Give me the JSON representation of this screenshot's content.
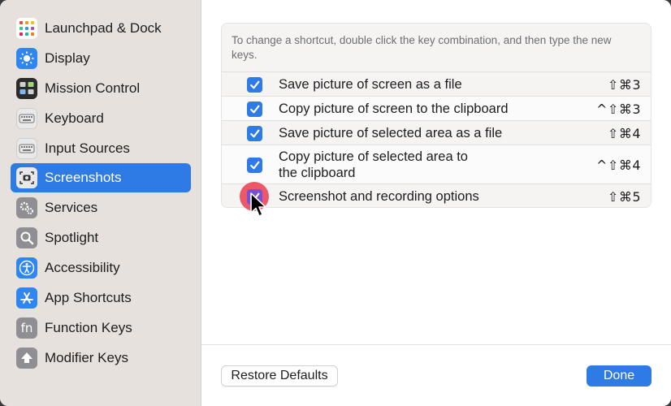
{
  "sidebar": {
    "items": [
      {
        "label": "Launchpad & Dock",
        "icon": "launchpad-icon"
      },
      {
        "label": "Display",
        "icon": "display-icon"
      },
      {
        "label": "Mission Control",
        "icon": "mission-control-icon"
      },
      {
        "label": "Keyboard",
        "icon": "keyboard-icon"
      },
      {
        "label": "Input Sources",
        "icon": "input-sources-icon"
      },
      {
        "label": "Screenshots",
        "icon": "screenshots-icon",
        "selected": true
      },
      {
        "label": "Services",
        "icon": "services-icon"
      },
      {
        "label": "Spotlight",
        "icon": "spotlight-icon"
      },
      {
        "label": "Accessibility",
        "icon": "accessibility-icon"
      },
      {
        "label": "App Shortcuts",
        "icon": "app-shortcuts-icon"
      },
      {
        "label": "Function Keys",
        "icon": "function-keys-icon",
        "glyph": "fn"
      },
      {
        "label": "Modifier Keys",
        "icon": "modifier-keys-icon"
      }
    ]
  },
  "main": {
    "hint": "To change a shortcut, double click the key combination, and then type the new keys.",
    "shortcuts": [
      {
        "label": "Save picture of screen as a file",
        "keys": "⇧⌘3",
        "checked": true
      },
      {
        "label": "Copy picture of screen to the clipboard",
        "keys": "^⇧⌘3",
        "checked": true
      },
      {
        "label": "Save picture of selected area as a file",
        "keys": "⇧⌘4",
        "checked": true
      },
      {
        "label": "Copy picture of selected area to the clipboard",
        "label_line1": "Copy picture of selected area to",
        "label_line2": "the clipboard",
        "keys": "^⇧⌘4",
        "checked": true
      },
      {
        "label": "Screenshot and recording options",
        "keys": "⇧⌘5",
        "checked": true
      }
    ],
    "restore_label": "Restore Defaults",
    "done_label": "Done"
  },
  "colors": {
    "accent": "#2f7be5",
    "click_highlight": "#eb3c50"
  }
}
